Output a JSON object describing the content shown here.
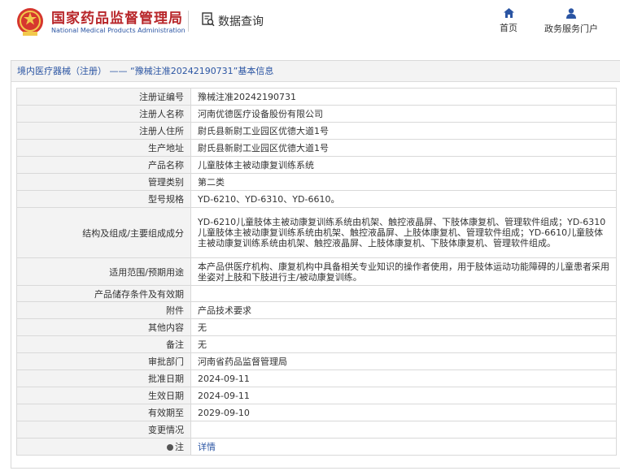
{
  "header": {
    "brand_cn": "国家药品监督管理局",
    "brand_en": "National Medical Products Administration",
    "query_label": "数据查询",
    "nav": [
      {
        "label": "首页",
        "icon": "home-icon"
      },
      {
        "label": "政务服务门户",
        "icon": "user-icon"
      }
    ]
  },
  "title": {
    "category": "境内医疗器械（注册）",
    "separator": "——",
    "subject": "“豫械注准20242190731”基本信息"
  },
  "rows": [
    {
      "label": "注册证编号",
      "value": "豫械注准20242190731"
    },
    {
      "label": "注册人名称",
      "value": "河南优德医疗设备股份有限公司"
    },
    {
      "label": "注册人住所",
      "value": "尉氏县新尉工业园区优德大道1号"
    },
    {
      "label": "生产地址",
      "value": "尉氏县新尉工业园区优德大道1号"
    },
    {
      "label": "产品名称",
      "value": "儿童肢体主被动康复训练系统"
    },
    {
      "label": "管理类别",
      "value": "第二类"
    },
    {
      "label": "型号规格",
      "value": "YD-6210、YD-6310、YD-6610。"
    },
    {
      "label": "结构及组成/主要组成成分",
      "value": "YD-6210儿童肢体主被动康复训练系统由机架、触控液晶屏、下肢体康复机、管理软件组成；YD-6310儿童肢体主被动康复训练系统由机架、触控液晶屏、上肢体康复机、管理软件组成；YD-6610儿童肢体主被动康复训练系统由机架、触控液晶屏、上肢体康复机、下肢体康复机、管理软件组成。"
    },
    {
      "label": "适用范围/预期用途",
      "value": "本产品供医疗机构、康复机构中具备相关专业知识的操作者使用，用于肢体运动功能障碍的儿童患者采用坐姿对上肢和下肢进行主/被动康复训练。"
    },
    {
      "label": "产品储存条件及有效期",
      "value": ""
    },
    {
      "label": "附件",
      "value": "产品技术要求"
    },
    {
      "label": "其他内容",
      "value": "无"
    },
    {
      "label": "备注",
      "value": "无"
    },
    {
      "label": "审批部门",
      "value": "河南省药品监督管理局"
    },
    {
      "label": "批准日期",
      "value": "2024-09-11"
    },
    {
      "label": "生效日期",
      "value": "2024-09-11"
    },
    {
      "label": "有效期至",
      "value": "2029-09-10"
    },
    {
      "label": "变更情况",
      "value": ""
    }
  ],
  "note_row": {
    "label": "注",
    "link": "详情"
  },
  "colors": {
    "brand_red": "#b8262a",
    "link_blue": "#2b55a3",
    "label_bg": "#f3f3f3",
    "border": "#d9d9d9"
  }
}
